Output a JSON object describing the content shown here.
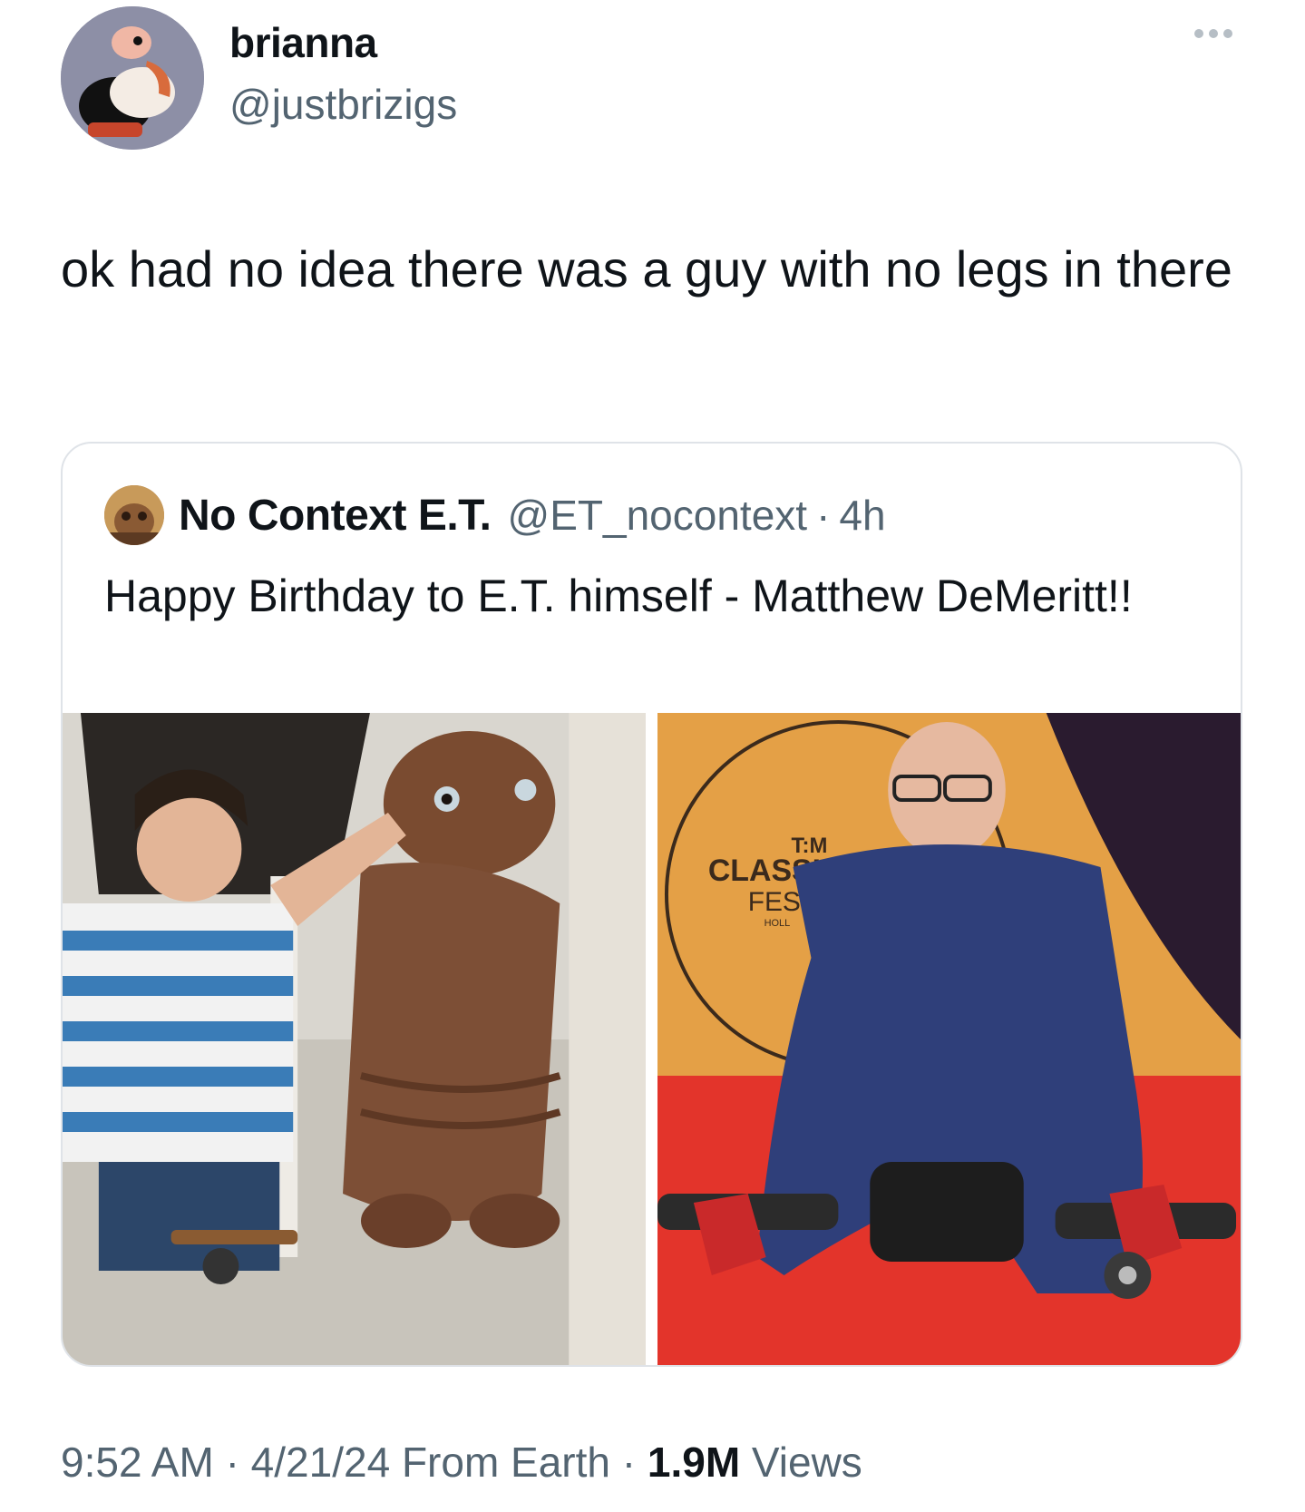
{
  "tweet": {
    "author": {
      "display_name": "brianna",
      "handle": "@justbrizigs",
      "avatar_icon": "cartoon-vulture-avatar"
    },
    "more_icon": "more-options-icon",
    "text": "ok had no idea there was a guy with no legs in there",
    "timestamp": "9:52 AM",
    "date": "4/21/24",
    "source": "From Earth",
    "separator": "·",
    "views_count": "1.9M",
    "views_label": "Views"
  },
  "quoted_tweet": {
    "author": {
      "display_name": "No Context E.T.",
      "handle": "@ET_nocontext",
      "avatar_icon": "et-avatar"
    },
    "separator": "·",
    "time_ago": "4h",
    "text": "Happy Birthday to E.T. himself - Matthew DeMeritt!!",
    "media": [
      {
        "description_icon": "photo-boy-with-et"
      },
      {
        "description_icon": "photo-man-on-red-carpet",
        "backdrop_text": [
          "T:M",
          "CLASSIC",
          "FES",
          "HOLL"
        ]
      }
    ]
  },
  "colors": {
    "text_primary": "#0f1419",
    "text_secondary": "#536471",
    "border": "#dfe3e8"
  }
}
